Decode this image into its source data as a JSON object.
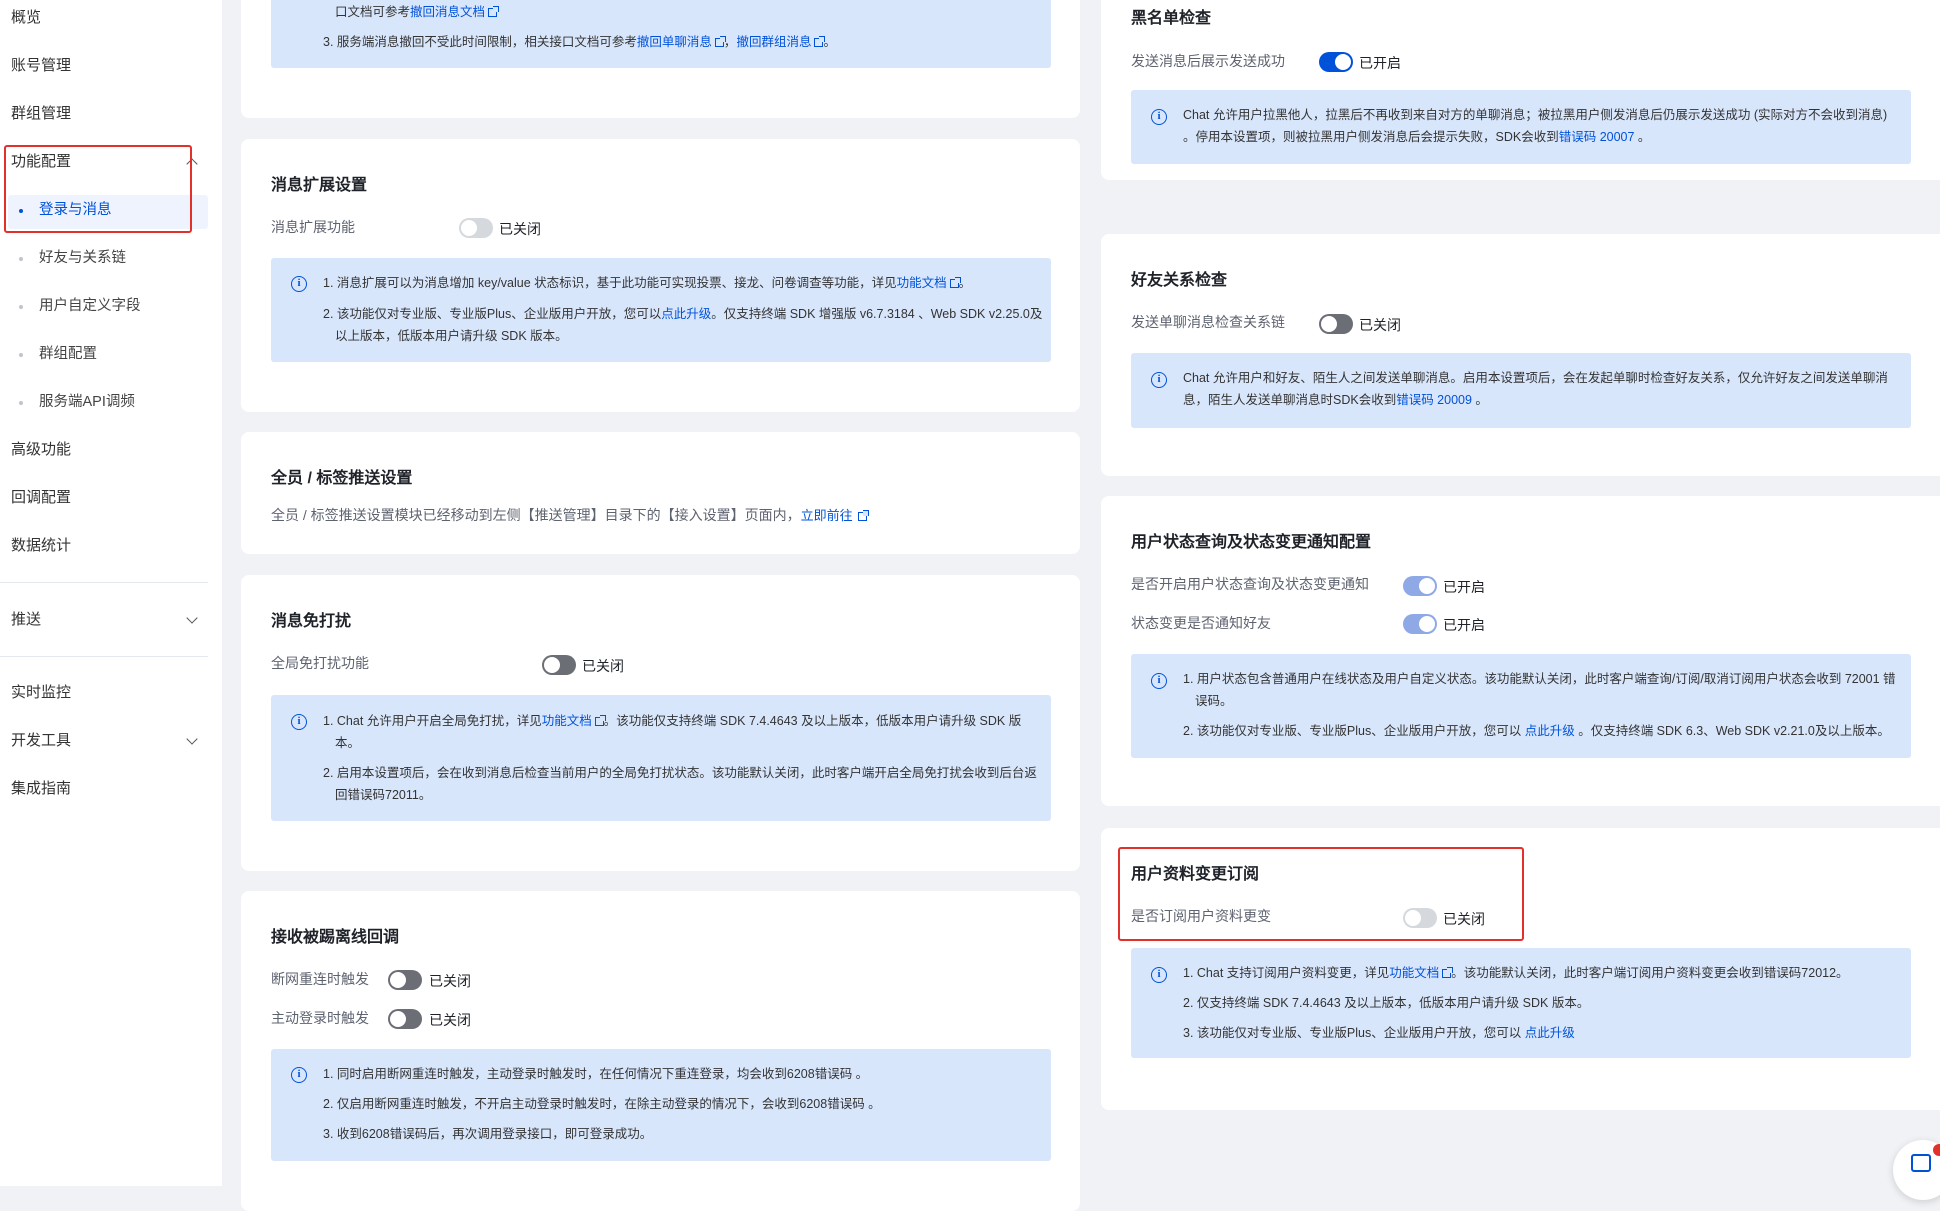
{
  "sidebar": {
    "overview": "概览",
    "account": "账号管理",
    "group": "群组管理",
    "feature": "功能配置",
    "sub_login": "登录与消息",
    "sub_friends": "好友与关系链",
    "sub_custom": "用户自定义字段",
    "sub_groupcfg": "群组配置",
    "sub_server": "服务端API调频",
    "advanced": "高级功能",
    "callback": "回调配置",
    "stats": "数据统计",
    "push": "推送",
    "monitor": "实时监控",
    "devtools": "开发工具",
    "guide": "集成指南"
  },
  "recall": {
    "l1a": "口文档可参考",
    "l1_link": "撤回消息文档",
    "l2a": "3. 服务端消息撤回不受此时间限制，相关接口文档可参考",
    "l2_link1": "撤回单聊消息",
    "l2_sep": "，",
    "l2_link2": "撤回群组消息",
    "l2_end": "。"
  },
  "ext": {
    "title": "消息扩展设置",
    "label": "消息扩展功能",
    "state": "已关闭",
    "l1a": "1. 消息扩展可以为消息增加 key/value 状态标识，基于此功能可实现投票、接龙、问卷调查等功能，详见",
    "l1_link": "功能文档",
    "l1_end": "。",
    "l2a": "2. 该功能仅对专业版、专业版Plus、企业版用户开放，您可以",
    "l2_link": "点此升级",
    "l2b": "。仅支持终端 SDK 增强版 v6.7.3184 、Web SDK v2.25.0及",
    "l3": "以上版本，低版本用户请升级 SDK 版本。"
  },
  "allpush": {
    "title": "全员 / 标签推送设置",
    "desc": "全员 / 标签推送设置模块已经移动到左侧【推送管理】目录下的【接入设置】页面内，",
    "link": "立即前往"
  },
  "dnd": {
    "title": "消息免打扰",
    "label": "全局免打扰功能",
    "state": "已关闭",
    "l1a": "1. Chat 允许用户开启全局免打扰，详见",
    "l1_link": "功能文档",
    "l1b": "。该功能仅支持终端 SDK 7.4.4643 及以上版本，低版本用户请升级 SDK 版",
    "l2": "本。",
    "l3": "2. 启用本设置项后，会在收到消息后检查当前用户的全局免打扰状态。该功能默认关闭，此时客户端开启全局免打扰会收到后台返",
    "l4": "回错误码72011。"
  },
  "kick": {
    "title": "接收被踢离线回调",
    "label1": "断网重连时触发",
    "state1": "已关闭",
    "label2": "主动登录时触发",
    "state2": "已关闭",
    "l1": "1. 同时启用断网重连时触发，主动登录时触发时，在任何情况下重连登录，均会收到6208错误码 。",
    "l2": "2. 仅启用断网重连时触发，不开启主动登录时触发时，在除主动登录的情况下，会收到6208错误码 。",
    "l3": "3. 收到6208错误码后，再次调用登录接口，即可登录成功。"
  },
  "blacklist": {
    "title": "黑名单检查",
    "label": "发送消息后展示发送成功",
    "state": "已开启",
    "l1": "Chat 允许用户拉黑他人，拉黑后不再收到来自对方的单聊消息；被拉黑用户侧发消息后仍展示发送成功 (实际对方不会收到消息)",
    "l2a": "。停用本设置项，则被拉黑用户侧发消息后会提示失败，SDK会收到",
    "l2_link": "错误码 20007",
    "l2_end": " 。"
  },
  "friend": {
    "title": "好友关系检查",
    "label": "发送单聊消息检查关系链",
    "state": "已关闭",
    "l1": "Chat 允许用户和好友、陌生人之间发送单聊消息。启用本设置项后，会在发起单聊时检查好友关系，仅允许好友之间发送单聊消",
    "l2a": "息，陌生人发送单聊消息时SDK会收到",
    "l2_link": "错误码 20009",
    "l2_end": " 。"
  },
  "status": {
    "title": "用户状态查询及状态变更通知配置",
    "label1": "是否开启用户状态查询及状态变更通知",
    "state1": "已开启",
    "label2": "状态变更是否通知好友",
    "state2": "已开启",
    "l1": "1. 用户状态包含普通用户在线状态及用户自定义状态。该功能默认关闭，此时客户端查询/订阅/取消订阅用户状态会收到 72001 错",
    "l2": "误码。",
    "l3a": "2. 该功能仅对专业版、专业版Plus、企业版用户开放，您可以 ",
    "l3_link": "点此升级",
    "l3b": " 。仅支持终端 SDK 6.3、Web SDK v2.21.0及以上版本。"
  },
  "profile": {
    "title": "用户资料变更订阅",
    "label": "是否订阅用户资料更变",
    "state": "已关闭",
    "l1a": "1. Chat 支持订阅用户资料变更，详见",
    "l1_link": "功能文档",
    "l1b": "。该功能默认关闭，此时客户端订阅用户资料变更会收到错误码72012。",
    "l2": "2. 仅支持终端 SDK 7.4.4643 及以上版本，低版本用户请升级 SDK 版本。",
    "l3a": "3. 该功能仅对专业版、专业版Plus、企业版用户开放，您可以 ",
    "l3_link": "点此升级"
  },
  "colors": {
    "accent": "#0052d9",
    "highlight": "#e2312b",
    "info_bg": "#d8e6fc"
  },
  "icons": [
    "info-icon",
    "external-link-icon",
    "chevron-up-icon",
    "chevron-down-icon",
    "feedback-icon"
  ]
}
